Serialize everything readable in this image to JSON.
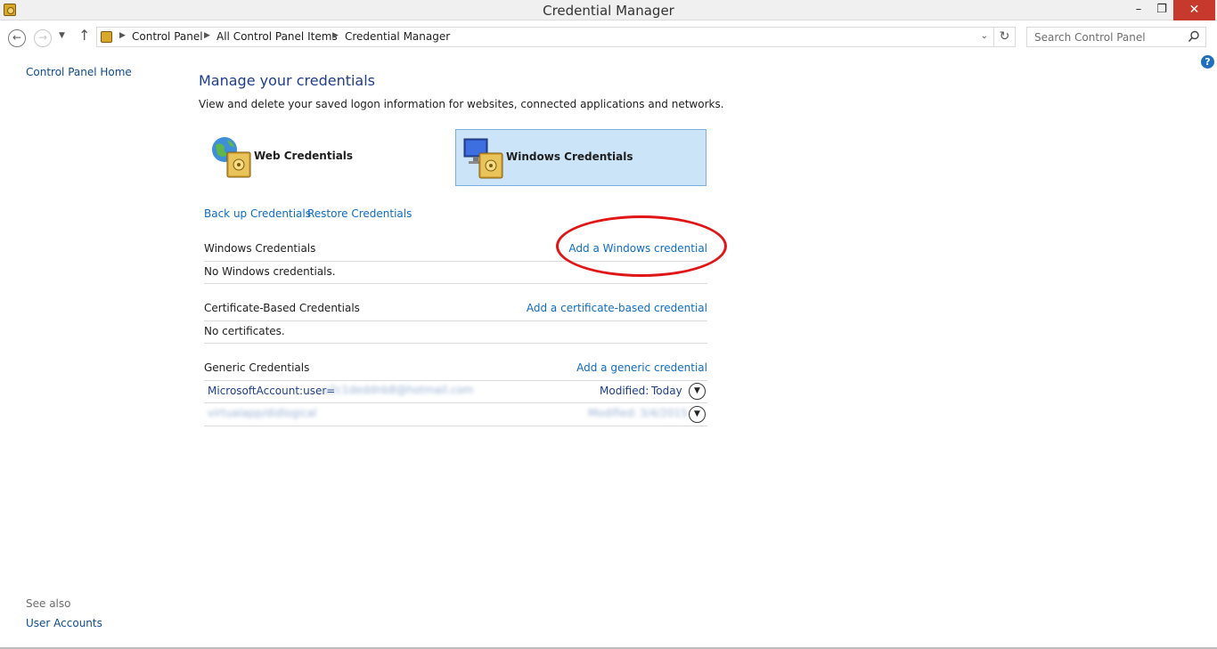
{
  "window": {
    "title": "Credential Manager",
    "minimize": "–",
    "restore": "❐",
    "close": "✕"
  },
  "nav": {
    "breadcrumb": [
      "Control Panel",
      "All Control Panel Items",
      "Credential Manager"
    ],
    "search_placeholder": "Search Control Panel"
  },
  "sidebar": {
    "home": "Control Panel Home",
    "see_also": "See also",
    "user_accounts": "User Accounts"
  },
  "main": {
    "title": "Manage your credentials",
    "description": "View and delete your saved logon information for websites, connected applications and networks.",
    "tiles": {
      "web": "Web Credentials",
      "windows": "Windows Credentials",
      "selected": "windows"
    },
    "backup": "Back up Credentials",
    "restore": "Restore Credentials",
    "windows_section": {
      "title": "Windows Credentials",
      "action": "Add a Windows credential",
      "empty": "No Windows credentials."
    },
    "cert_section": {
      "title": "Certificate-Based Credentials",
      "action": "Add a certificate-based credential",
      "empty": "No certificates."
    },
    "generic_section": {
      "title": "Generic Credentials",
      "action": "Add a generic credential",
      "items": [
        {
          "name": "MicrosoftAccount:user=",
          "blurred": "[blurred]",
          "modified_label": "Modified:",
          "modified": "Today"
        },
        {
          "name": "",
          "blurred": "[blurred]",
          "modified_label": "Modified:",
          "modified": "[blurred]"
        }
      ]
    }
  },
  "colors": {
    "link": "#0e6cc0",
    "title": "#1e3e8a",
    "selected_tile": "#cce4f7",
    "annotation": "#e01616"
  },
  "icons": [
    "back-icon",
    "forward-icon",
    "up-icon",
    "refresh-icon",
    "search-icon",
    "help-icon",
    "expand-icon"
  ]
}
